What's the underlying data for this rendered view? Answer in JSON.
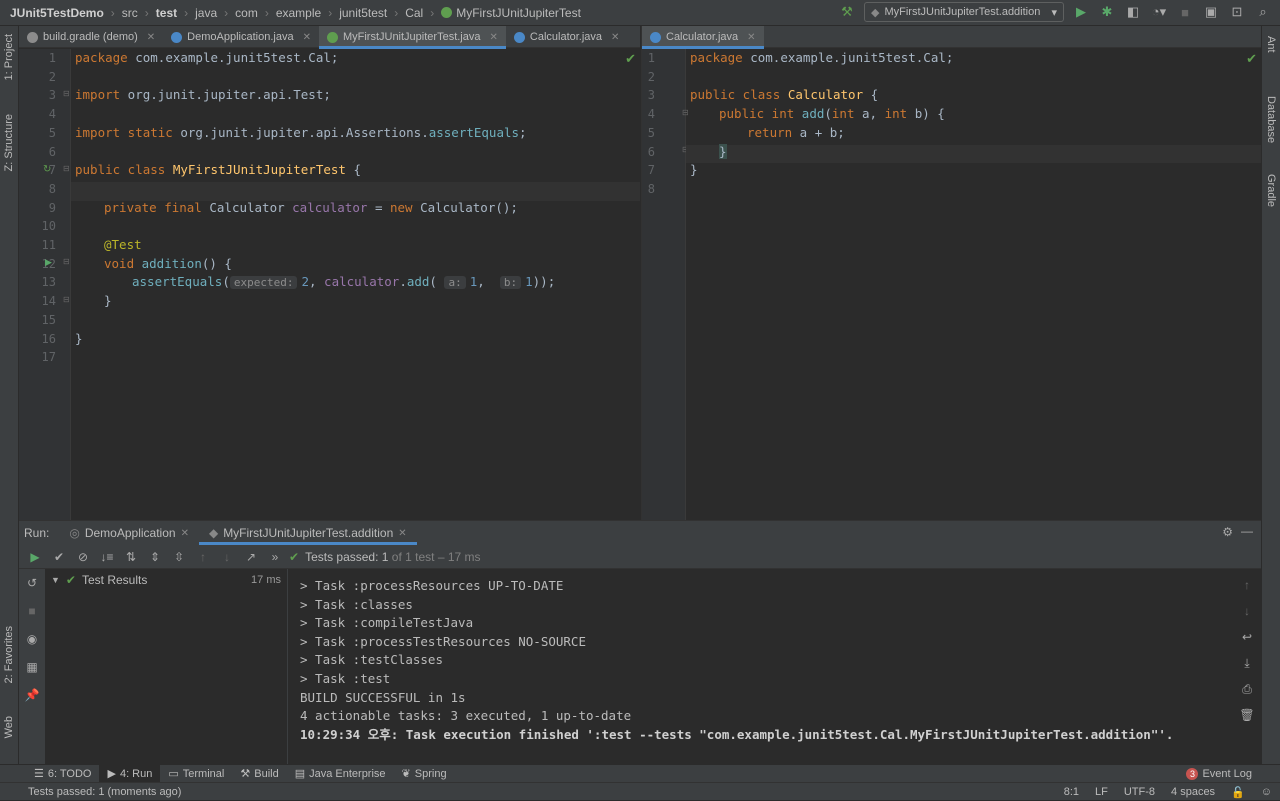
{
  "nav": {
    "crumbs": [
      "JUnit5TestDemo",
      "src",
      "test",
      "java",
      "com",
      "example",
      "junit5test",
      "Cal",
      "MyFirstJUnitJupiterTest"
    ],
    "run_config": "MyFirstJUnitJupiterTest.addition"
  },
  "left_strip": {
    "project": "1: Project",
    "structure": "Z: Structure",
    "favorites": "2: Favorites",
    "web": "Web"
  },
  "right_strip": {
    "ant": "Ant",
    "database": "Database",
    "gradle": "Gradle"
  },
  "editor1": {
    "tabs": [
      {
        "label": "build.gradle (demo)",
        "color": "#8c8c8c"
      },
      {
        "label": "DemoApplication.java",
        "color": "#4a88c7"
      },
      {
        "label": "MyFirstJUnitJupiterTest.java",
        "color": "#5f9e4f"
      },
      {
        "label": "Calculator.java",
        "color": "#4a88c7"
      }
    ],
    "line_numbers": [
      "1",
      "2",
      "3",
      "4",
      "5",
      "6",
      "7",
      "8",
      "9",
      "10",
      "11",
      "12",
      "13",
      "14",
      "15",
      "16",
      "17"
    ],
    "code": {
      "l1_kw": "package",
      "l1_rest": " com.example.junit5test.Cal;",
      "l3_kw": "import",
      "l3_rest": " org.junit.jupiter.api.Test;",
      "l5_kw": "import static",
      "l5_rest": " org.junit.jupiter.api.Assertions.",
      "l5_fn": "assertEquals",
      "l5_end": ";",
      "l7_kw": "public class",
      "l7_cls": "MyFirstJUnitJupiterTest",
      "l7_end": " {",
      "l9_kw": "private final",
      "l9_type": " Calculator ",
      "l9_field": "calculator",
      "l9_eq": " = ",
      "l9_new": "new",
      "l9_end": " Calculator();",
      "l11_ann": "@Test",
      "l12_kw": "void",
      "l12_fn": " addition",
      "l12_end": "() {",
      "l13_fn": "assertEquals",
      "l13_open": "(",
      "l13_hint1": "expected:",
      "l13_n1": "2",
      ", ": ", ",
      "l13_field": "calculator",
      "l13_dot": ".",
      "l13_call": "add",
      "l13_hint2": "a:",
      "l13_n2": "1",
      "l13_comma": ", ",
      "l13_hint3": "b:",
      "l13_n3": "1",
      "l13_close": "));",
      "l14": "}",
      "l16": "}"
    }
  },
  "editor2": {
    "tab": "Calculator.java",
    "line_numbers": [
      "1",
      "2",
      "3",
      "4",
      "5",
      "6",
      "7",
      "8"
    ],
    "code": {
      "l1_kw": "package",
      "l1_rest": " com.example.junit5test.Cal;",
      "l3_kw": "public class",
      "l3_cls": " Calculator",
      "l3_end": " {",
      "l4_kw": "public int",
      "l4_fn": " add",
      "l4_p": "(",
      "l4_k1": "int",
      "l4_a": " a, ",
      "l4_k2": "int",
      "l4_b": " b) {",
      "l5_kw": "return",
      "l5_rest": " a + b;",
      "l6": "}",
      "l7": "}"
    }
  },
  "run": {
    "label": "Run:",
    "tabs": [
      "DemoApplication",
      "MyFirstJUnitJupiterTest.addition"
    ],
    "status_prefix": "Tests passed: ",
    "status_count": "1",
    "status_rest": " of 1 test – 17 ms",
    "tree_root": "Test Results",
    "tree_time": "17 ms",
    "console": [
      "> Task :processResources UP-TO-DATE",
      "> Task :classes",
      "> Task :compileTestJava",
      "> Task :processTestResources NO-SOURCE",
      "> Task :testClasses",
      "> Task :test",
      "BUILD SUCCESSFUL in 1s",
      "4 actionable tasks: 3 executed, 1 up-to-date",
      "10:29:34 오후: Task execution finished ':test --tests \"com.example.junit5test.Cal.MyFirstJUnitJupiterTest.addition\"'."
    ]
  },
  "bottom_tabs": {
    "todo": "6: TODO",
    "run": "4: Run",
    "terminal": "Terminal",
    "build": "Build",
    "javaee": "Java Enterprise",
    "spring": "Spring",
    "eventlog": "Event Log",
    "eventcount": "3"
  },
  "status": {
    "message": "Tests passed: 1 (moments ago)",
    "pos": "8:1",
    "lf": "LF",
    "enc": "UTF-8",
    "indent": "4 spaces"
  }
}
